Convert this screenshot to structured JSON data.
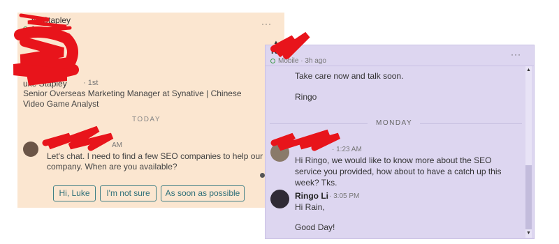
{
  "left_panel": {
    "name_partial": "ke Stapley",
    "status": "A...",
    "more_label": "···",
    "profile_name_partial": "uke Stapley",
    "connection_degree": "· 1st",
    "headline": "Senior Overseas Marketing Manager at Synative | Chinese Video Game Analyst",
    "date_divider": "TODAY",
    "message_time": "AM",
    "message_text": "Let's chat. I need to find a few SEO companies to help our company. When are you available?",
    "quick_replies": [
      "Hi, Luke",
      "I'm not sure",
      "As soon as possible"
    ]
  },
  "right_panel": {
    "name_partial": "R",
    "status": "Mobile · 3h ago",
    "more_label": "···",
    "earlier_messages": [
      "Take care now and talk soon.",
      "Ringo"
    ],
    "date_divider": "MONDAY",
    "message1": {
      "time": "· 1:23 AM",
      "text": "Hi Ringo, we would like to know more about the SEO service you provided, how about to have a catch up this week? Tks."
    },
    "message2": {
      "sender": "Ringo Li",
      "time": "· 3:05 PM",
      "lines": [
        "Hi Rain,",
        "Good Day!"
      ]
    }
  },
  "colors": {
    "left_bg": "#fbe6d0",
    "right_bg": "#ddd6f0",
    "accent_teal": "#3f7f85",
    "online_green": "#3c9a4c",
    "redaction_red": "#e8141b"
  }
}
